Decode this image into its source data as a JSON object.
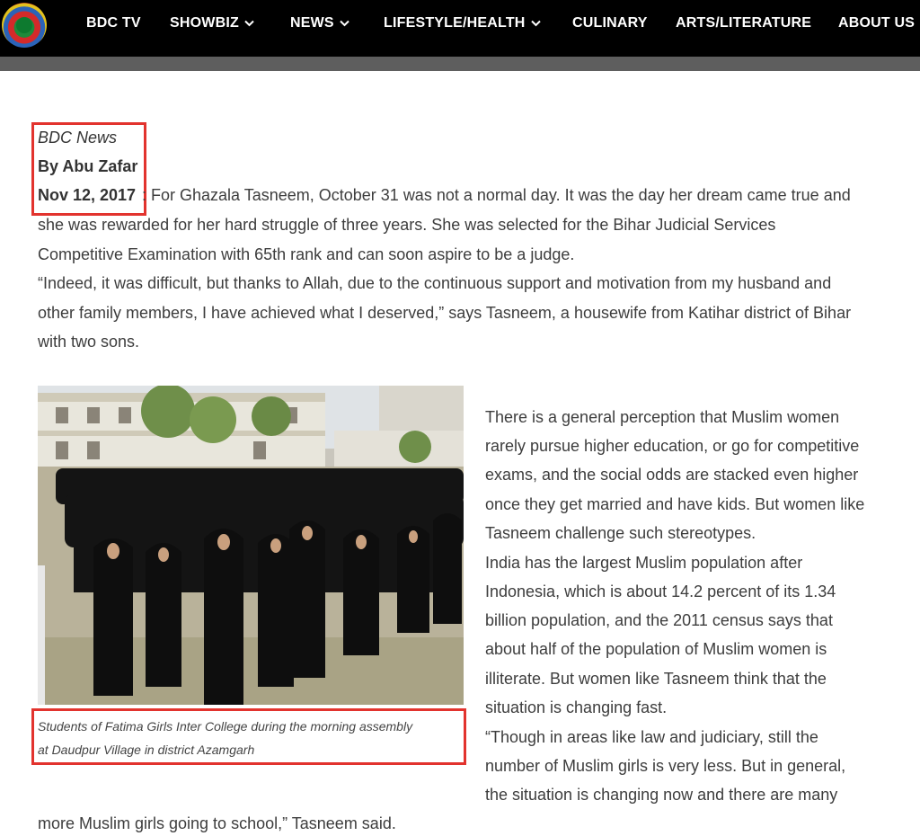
{
  "nav": {
    "logo_icon": "bdc-logo-icon",
    "items": [
      {
        "label": "BDC TV",
        "has_dropdown": false
      },
      {
        "label": "SHOWBIZ",
        "has_dropdown": true
      },
      {
        "label": "NEWS",
        "has_dropdown": true
      },
      {
        "label": "LIFESTYLE/HEALTH",
        "has_dropdown": true
      },
      {
        "label": "CULINARY",
        "has_dropdown": false
      },
      {
        "label": "ARTS/LITERATURE",
        "has_dropdown": false
      },
      {
        "label": "ABOUT US",
        "has_dropdown": false
      }
    ]
  },
  "colors": {
    "nav_bg": "#000000",
    "highlight_box": "#e2332e",
    "band": "#5e5e5e"
  },
  "article": {
    "source": "BDC News",
    "author": "By Abu Zafar",
    "date": "Nov 12, 2017",
    "lines": [
      ": For Ghazala Tasneem, October 31 was not a normal day. It was the day her dream came true and",
      "she was rewarded for her hard struggle of three years. She was selected for the Bihar Judicial Services",
      "Competitive Examination with 65th rank and can soon aspire to be a judge.",
      "“Indeed, it was difficult, but thanks to Allah, due to the continuous support and motivation from my husband and",
      "other family members, I have achieved what I deserved,” says Tasneem, a housewife from Katihar district of Bihar",
      "with two sons."
    ],
    "right_column": [
      "There is a general perception that Muslim women",
      "rarely pursue higher education, or go for competitive",
      "exams, and the social odds are stacked even higher",
      "once they get married and have kids. But women like",
      "Tasneem challenge such stereotypes.",
      "India has the largest Muslim population after",
      "Indonesia, which is about 14.2 percent of its 1.34",
      "billion population, and the 2011 census says that",
      "about half of the population of Muslim women is",
      "illiterate. But women like Tasneem think that the",
      "situation is changing fast.",
      "“Though in areas like law and judiciary, still the",
      "number of Muslim girls is very less. But in general,",
      "the situation is changing now and there are many"
    ],
    "final_line": "more Muslim girls going to school,” Tasneem said.",
    "caption": [
      "Students of Fatima Girls Inter College during the morning assembly",
      "at Daudpur Village in district Azamgarh"
    ]
  }
}
